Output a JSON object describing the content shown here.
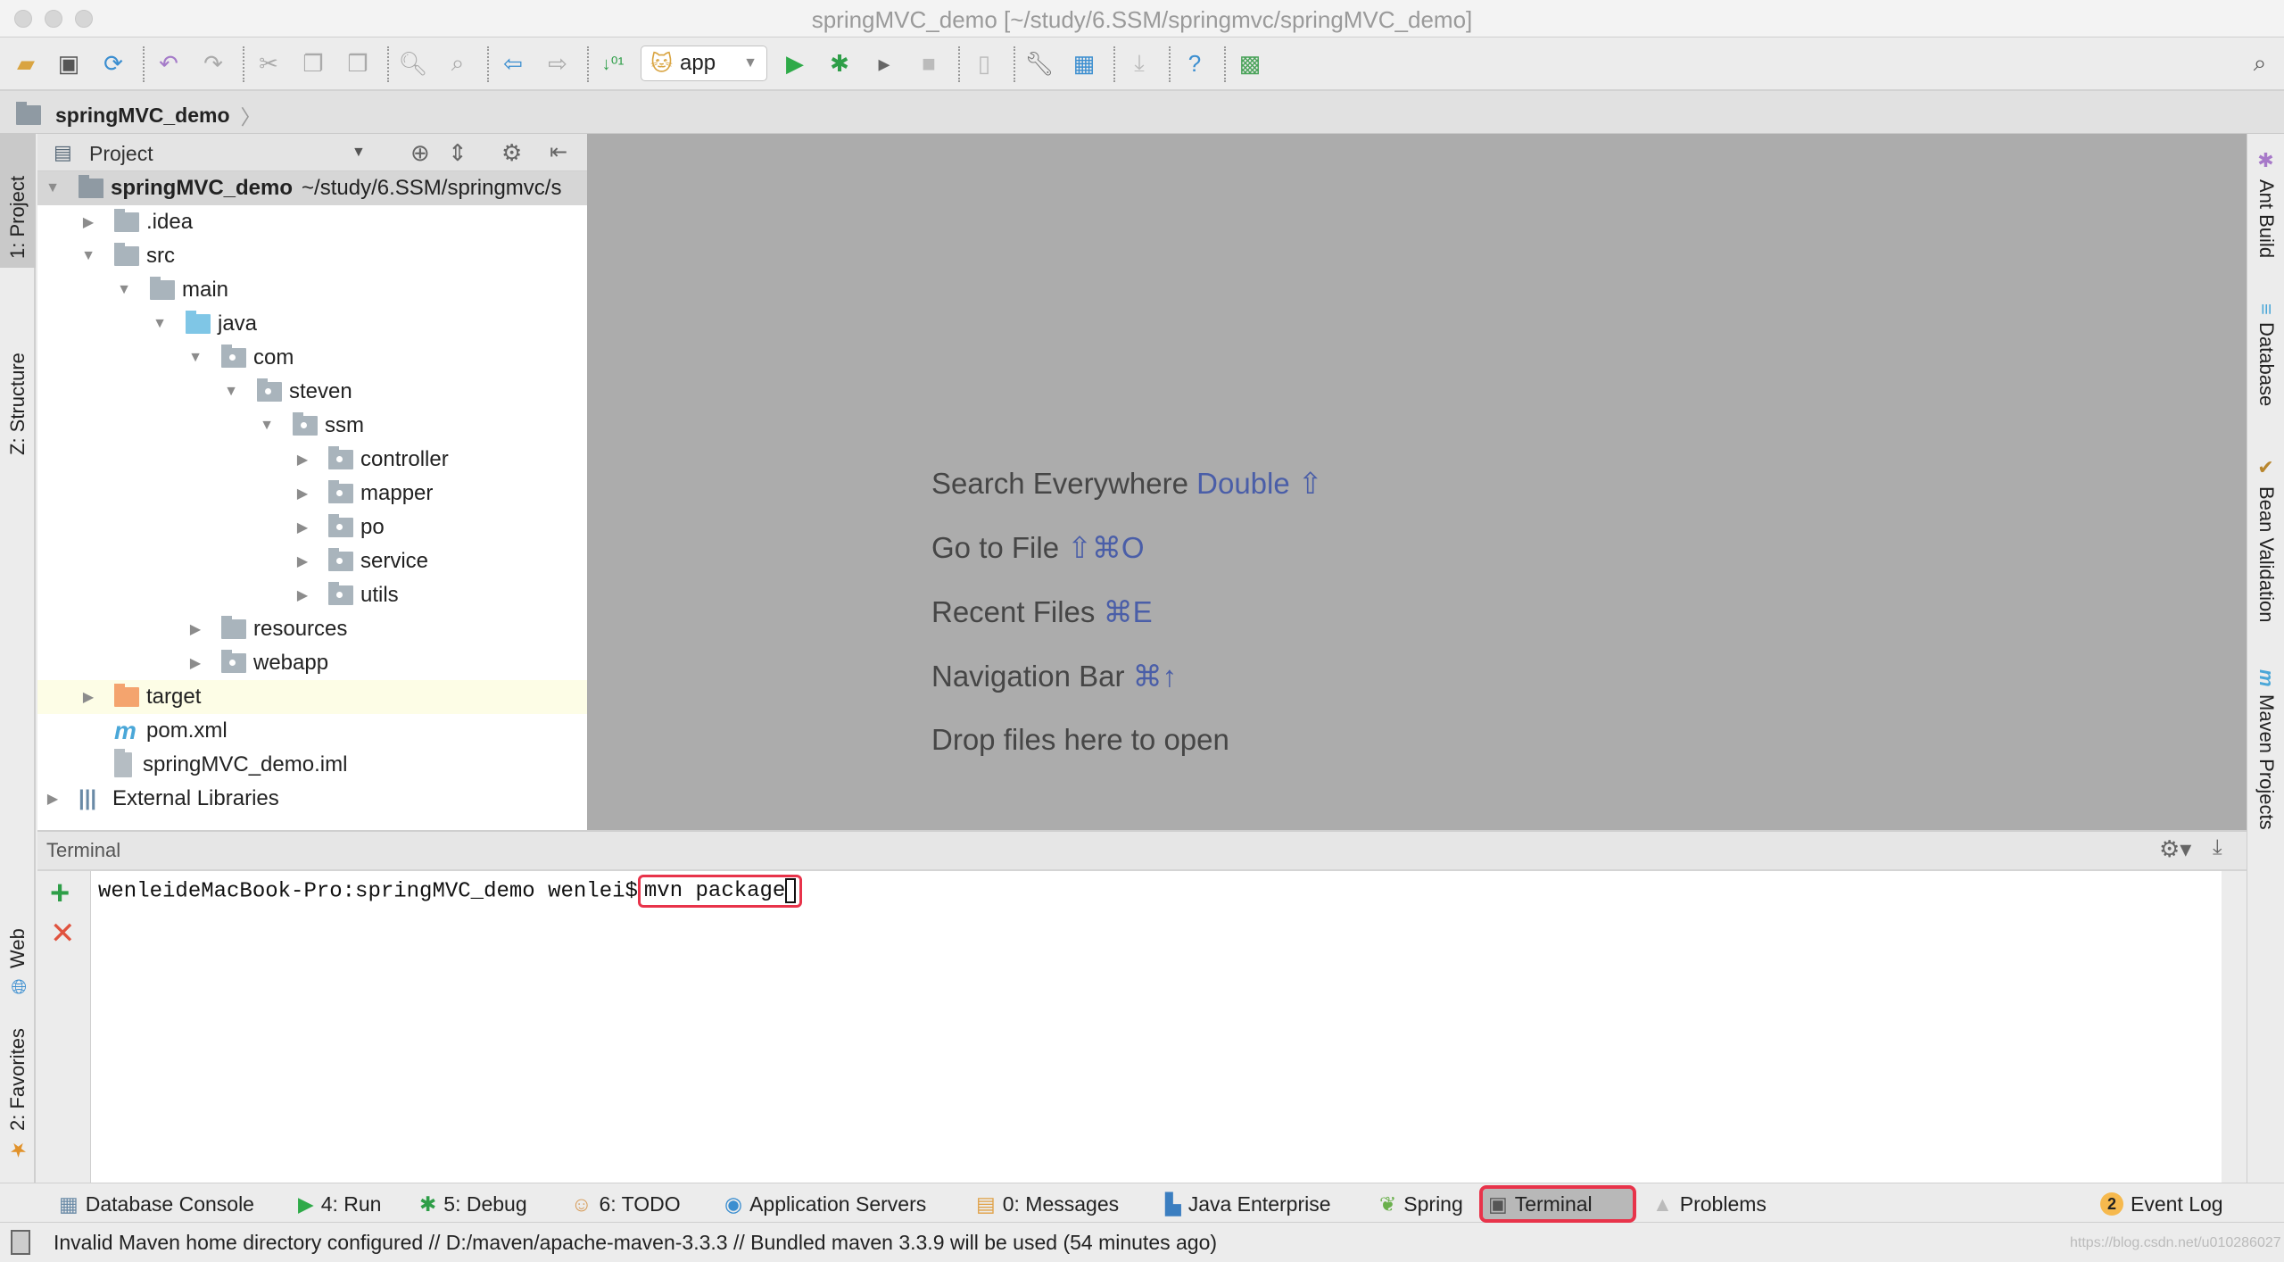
{
  "window": {
    "title": "springMVC_demo [~/study/6.SSM/springmvc/springMVC_demo]"
  },
  "toolbar": {
    "run_config": "app",
    "icons": [
      "open-folder",
      "save-all",
      "synchronize",
      "undo",
      "redo",
      "cut",
      "copy",
      "paste",
      "find",
      "replace",
      "back",
      "forward",
      "make-project",
      "run",
      "debug",
      "run-with-coverage",
      "stop",
      "android-device",
      "project-structure",
      "sdk-manager",
      "android-sync",
      "help",
      "jvm-debug"
    ]
  },
  "breadcrumb": {
    "project": "springMVC_demo"
  },
  "left_stripe": {
    "project_tab": "1: Project",
    "structure_tab": "Z: Structure",
    "web_tab": "Web",
    "favorites_tab": "2: Favorites"
  },
  "right_stripe": {
    "tabs": [
      "Ant Build",
      "Database",
      "Bean Validation",
      "Maven Projects"
    ]
  },
  "project_panel": {
    "view_label": "Project",
    "root": {
      "name": "springMVC_demo",
      "path": "~/study/6.SSM/springmvc/s"
    },
    "rows": [
      {
        "label": ".idea",
        "arrow": "▶"
      },
      {
        "label": "src",
        "arrow": "▼"
      },
      {
        "label": "main",
        "arrow": "▼"
      },
      {
        "label": "java",
        "arrow": "▼"
      },
      {
        "label": "com",
        "arrow": "▼"
      },
      {
        "label": "steven",
        "arrow": "▼"
      },
      {
        "label": "ssm",
        "arrow": "▼"
      },
      {
        "label": "controller",
        "arrow": "▶"
      },
      {
        "label": "mapper",
        "arrow": "▶"
      },
      {
        "label": "po",
        "arrow": "▶"
      },
      {
        "label": "service",
        "arrow": "▶"
      },
      {
        "label": "utils",
        "arrow": "▶"
      },
      {
        "label": "resources",
        "arrow": "▶"
      },
      {
        "label": "webapp",
        "arrow": "▶"
      },
      {
        "label": "target",
        "arrow": "▶"
      },
      {
        "label": "pom.xml",
        "arrow": ""
      },
      {
        "label": "springMVC_demo.iml",
        "arrow": ""
      },
      {
        "label": "External Libraries",
        "arrow": "▶"
      }
    ]
  },
  "editor": {
    "hints": [
      {
        "text": "Search Everywhere",
        "shortcut": "Double ⇧"
      },
      {
        "text": "Go to File",
        "shortcut": "⇧⌘O"
      },
      {
        "text": "Recent Files",
        "shortcut": "⌘E"
      },
      {
        "text": "Navigation Bar",
        "shortcut": "⌘↑"
      },
      {
        "text": "Drop files here to open",
        "shortcut": ""
      }
    ]
  },
  "terminal": {
    "title": "Terminal",
    "prompt": "wenleideMacBook-Pro:springMVC_demo wenlei$",
    "command": "mvn package"
  },
  "tool_windows": [
    {
      "label": "Database Console"
    },
    {
      "label": "4: Run"
    },
    {
      "label": "5: Debug"
    },
    {
      "label": "6: TODO"
    },
    {
      "label": "Application Servers"
    },
    {
      "label": "0: Messages"
    },
    {
      "label": "Java Enterprise"
    },
    {
      "label": "Spring"
    },
    {
      "label": "Terminal",
      "active": true
    },
    {
      "label": "Problems"
    }
  ],
  "event_log": {
    "label": "Event Log",
    "count": "2"
  },
  "status": {
    "message": "Invalid Maven home directory configured // D:/maven/apache-maven-3.3.3 // Bundled maven 3.3.9 will be used (54 minutes ago)",
    "watermark": "https://blog.csdn.net/u010286027"
  },
  "colors": {
    "highlight": "#e8334a",
    "editor_bg": "#acacac",
    "shortcut": "#4a5ea8"
  }
}
